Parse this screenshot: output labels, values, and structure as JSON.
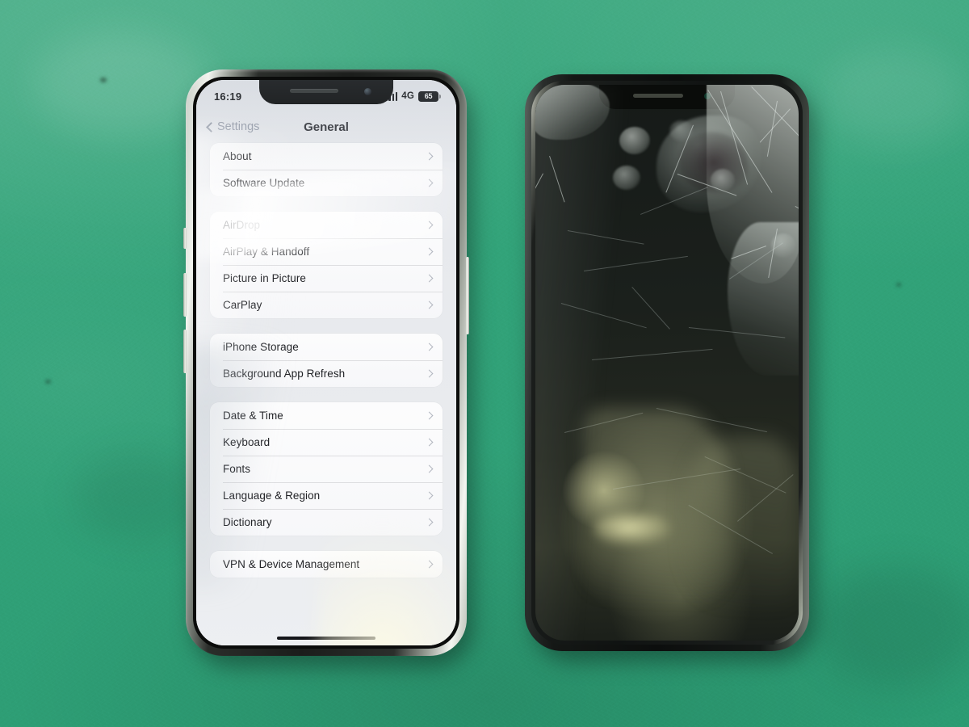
{
  "scene": {
    "description": "Two iPhones lying side by side on a green repair mat",
    "background_color": "#35a87c"
  },
  "left_phone": {
    "name": "working-iphone",
    "state": "screen on",
    "status_bar": {
      "time": "16:19",
      "network": "4G",
      "battery_percent": "65",
      "signal_icon": "cellular-signal-icon"
    },
    "nav": {
      "back_label": "Settings",
      "title": "General",
      "back_icon": "chevron-left-icon"
    },
    "groups": [
      {
        "rows": [
          {
            "label": "About",
            "accessory": "chevron-right-icon"
          },
          {
            "label": "Software Update",
            "accessory": "chevron-right-icon"
          }
        ]
      },
      {
        "rows": [
          {
            "label": "AirDrop",
            "accessory": "chevron-right-icon"
          },
          {
            "label": "AirPlay & Handoff",
            "accessory": "chevron-right-icon"
          },
          {
            "label": "Picture in Picture",
            "accessory": "chevron-right-icon"
          },
          {
            "label": "CarPlay",
            "accessory": "chevron-right-icon"
          }
        ]
      },
      {
        "rows": [
          {
            "label": "iPhone Storage",
            "accessory": "chevron-right-icon"
          },
          {
            "label": "Background App Refresh",
            "accessory": "chevron-right-icon"
          }
        ]
      },
      {
        "rows": [
          {
            "label": "Date & Time",
            "accessory": "chevron-right-icon"
          },
          {
            "label": "Keyboard",
            "accessory": "chevron-right-icon"
          },
          {
            "label": "Fonts",
            "accessory": "chevron-right-icon"
          },
          {
            "label": "Language & Region",
            "accessory": "chevron-right-icon"
          },
          {
            "label": "Dictionary",
            "accessory": "chevron-right-icon"
          }
        ]
      },
      {
        "rows": [
          {
            "label": "VPN & Device Management",
            "accessory": "chevron-right-icon"
          }
        ]
      }
    ],
    "hardware": {
      "notch_speaker": "earpiece-speaker",
      "notch_camera": "front-camera",
      "power_button": "power-button",
      "volume_up_button": "volume-up-button",
      "volume_down_button": "volume-down-button",
      "home_indicator": "home-indicator"
    }
  },
  "right_phone": {
    "name": "broken-iphone",
    "state": "screen off, glass shattered",
    "damage": "cracked and delaminated front glass with frosted shatter patches",
    "hardware": {
      "notch_speaker": "earpiece-speaker",
      "notch_camera": "front-camera"
    }
  }
}
